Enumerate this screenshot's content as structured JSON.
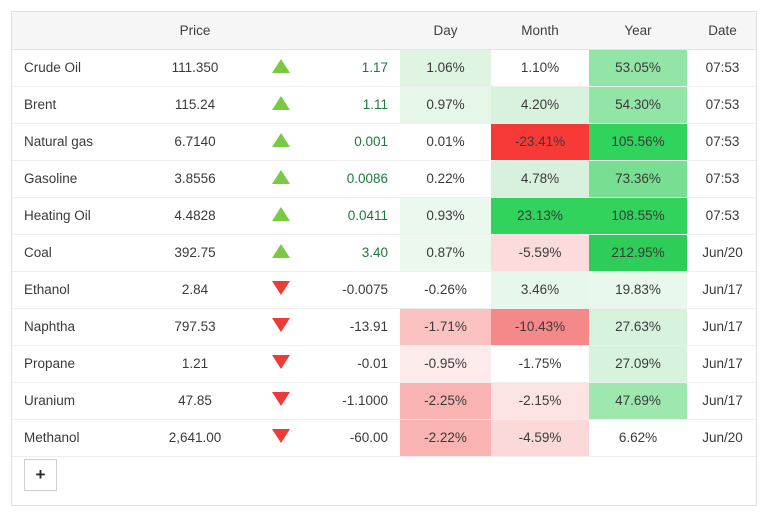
{
  "table": {
    "columns": [
      {
        "key": "name",
        "label": ""
      },
      {
        "key": "price",
        "label": "Price"
      },
      {
        "key": "arrow",
        "label": ""
      },
      {
        "key": "chg",
        "label": ""
      },
      {
        "key": "day",
        "label": "Day"
      },
      {
        "key": "month",
        "label": "Month"
      },
      {
        "key": "year",
        "label": "Year"
      },
      {
        "key": "date",
        "label": "Date"
      }
    ],
    "rows": [
      {
        "name": "Crude Oil",
        "price": "111.350",
        "direction": "up",
        "arrow_icon": "triangle-up-icon",
        "change": "1.17",
        "day": "1.06%",
        "day_bg": "#dff4e1",
        "month": "1.10%",
        "month_bg": "#ffffff",
        "year": "53.05%",
        "year_bg": "#93e5a7",
        "date": "07:53"
      },
      {
        "name": "Brent",
        "price": "115.24",
        "direction": "up",
        "arrow_icon": "triangle-up-icon",
        "change": "1.11",
        "day": "0.97%",
        "day_bg": "#e6f6e9",
        "month": "4.20%",
        "month_bg": "#d9f2de",
        "year": "54.30%",
        "year_bg": "#93e5a7",
        "date": "07:53"
      },
      {
        "name": "Natural gas",
        "price": "6.7140",
        "direction": "up",
        "arrow_icon": "triangle-up-icon",
        "change": "0.001",
        "day": "0.01%",
        "day_bg": "#ffffff",
        "month": "-23.41%",
        "month_bg": "#f73a37",
        "year": "105.56%",
        "year_bg": "#31d35c",
        "date": "07:53"
      },
      {
        "name": "Gasoline",
        "price": "3.8556",
        "direction": "up",
        "arrow_icon": "triangle-up-icon",
        "change": "0.0086",
        "day": "0.22%",
        "day_bg": "#ffffff",
        "month": "4.78%",
        "month_bg": "#d8f1dd",
        "year": "73.36%",
        "year_bg": "#78df92",
        "date": "07:53"
      },
      {
        "name": "Heating Oil",
        "price": "4.4828",
        "direction": "up",
        "arrow_icon": "triangle-up-icon",
        "change": "0.0411",
        "day": "0.93%",
        "day_bg": "#eaf8ed",
        "month": "23.13%",
        "month_bg": "#31d35c",
        "year": "108.55%",
        "year_bg": "#31d35c",
        "date": "07:53"
      },
      {
        "name": "Coal",
        "price": "392.75",
        "direction": "up",
        "arrow_icon": "triangle-up-icon",
        "change": "3.40",
        "day": "0.87%",
        "day_bg": "#eaf8ed",
        "month": "-5.59%",
        "month_bg": "#fbdbdb",
        "year": "212.95%",
        "year_bg": "#2ecc58",
        "date": "Jun/20"
      },
      {
        "name": "Ethanol",
        "price": "2.84",
        "direction": "down",
        "arrow_icon": "triangle-down-icon",
        "change": "-0.0075",
        "day": "-0.26%",
        "day_bg": "#ffffff",
        "month": "3.46%",
        "month_bg": "#e8f7ec",
        "year": "19.83%",
        "year_bg": "#e9f8ec",
        "date": "Jun/17"
      },
      {
        "name": "Naphtha",
        "price": "797.53",
        "direction": "down",
        "arrow_icon": "triangle-down-icon",
        "change": "-13.91",
        "day": "-1.71%",
        "day_bg": "#fbc2c2",
        "month": "-10.43%",
        "month_bg": "#f58888",
        "year": "27.63%",
        "year_bg": "#d7f3de",
        "date": "Jun/17"
      },
      {
        "name": "Propane",
        "price": "1.21",
        "direction": "down",
        "arrow_icon": "triangle-down-icon",
        "change": "-0.01",
        "day": "-0.95%",
        "day_bg": "#fdeaea",
        "month": "-1.75%",
        "month_bg": "#ffffff",
        "year": "27.09%",
        "year_bg": "#d7f3de",
        "date": "Jun/17"
      },
      {
        "name": "Uranium",
        "price": "47.85",
        "direction": "down",
        "arrow_icon": "triangle-down-icon",
        "change": "-1.1000",
        "day": "-2.25%",
        "day_bg": "#f9b3b3",
        "month": "-2.15%",
        "month_bg": "#fce4e4",
        "year": "47.69%",
        "year_bg": "#9ee8b0",
        "date": "Jun/17"
      },
      {
        "name": "Methanol",
        "price": "2,641.00",
        "direction": "down",
        "arrow_icon": "triangle-down-icon",
        "change": "-60.00",
        "day": "-2.22%",
        "day_bg": "#f9b3b3",
        "month": "-4.59%",
        "month_bg": "#fbd9d9",
        "year": "6.62%",
        "year_bg": "#ffffff",
        "date": "Jun/20"
      }
    ]
  },
  "footer": {
    "add_button_label": "+"
  },
  "colors": {
    "up_arrow": "#7ac943",
    "down_arrow": "#ef3b38",
    "up_text": "#1d7a3c",
    "header_bg": "#f6f6f6",
    "border": "#e0e0e0"
  }
}
